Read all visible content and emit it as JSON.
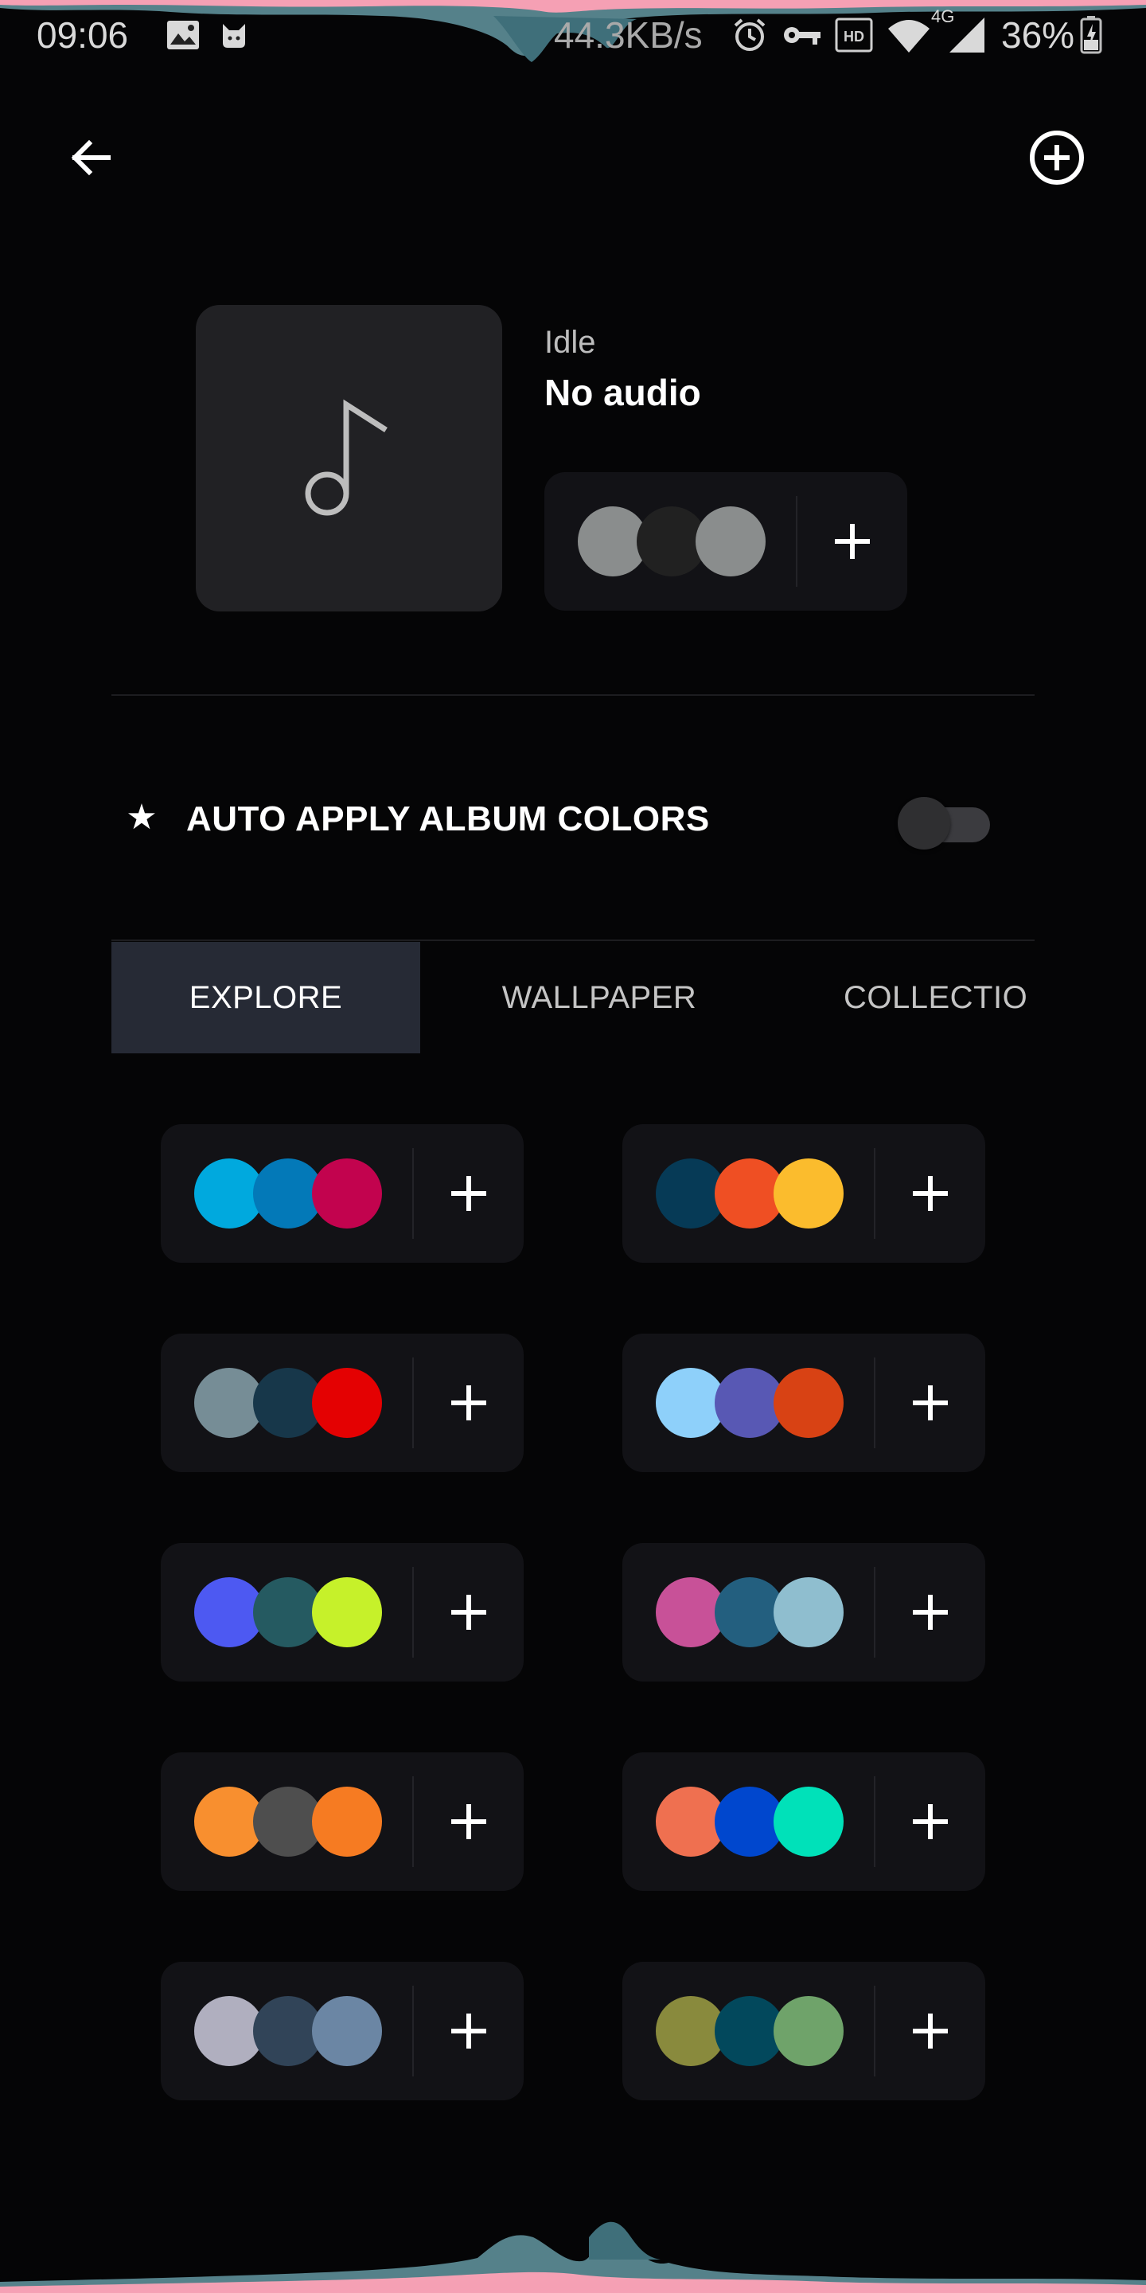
{
  "status_bar": {
    "time": "09:06",
    "net_speed": "44.3KB/s",
    "network_type": "4G",
    "battery": "36%",
    "icons": [
      "image-icon",
      "cat-icon",
      "alarm-icon",
      "vpn-key-icon",
      "hd-icon",
      "wifi-icon",
      "signal-icon",
      "battery-icon"
    ]
  },
  "header": {
    "back_icon": "arrow-back-icon",
    "add_icon": "add-circle-icon"
  },
  "now_playing": {
    "artwork_icon": "music-note-icon",
    "status": "Idle",
    "title": "No audio",
    "palette": [
      "#8a8d8d",
      "#212121",
      "#8a8d8d"
    ],
    "add_icon": "plus-icon"
  },
  "auto_apply": {
    "icon": "star-icon",
    "star_glyph": "★",
    "label": "AUTO APPLY ALBUM COLORS",
    "enabled": false
  },
  "tabs": [
    {
      "label": "EXPLORE",
      "active": true
    },
    {
      "label": "WALLPAPER",
      "active": false
    },
    {
      "label": "COLLECTIO",
      "active": false
    }
  ],
  "palettes": [
    [
      "#00a9de",
      "#0379b8",
      "#c2034e"
    ],
    [
      "#063a56",
      "#ef4f23",
      "#fbbc2d"
    ],
    [
      "#768d96",
      "#17374a",
      "#e40102"
    ],
    [
      "#8ed0fa",
      "#5858b4",
      "#d84214"
    ],
    [
      "#4d59f2",
      "#255a61",
      "#c6f12a"
    ],
    [
      "#c85198",
      "#235f7f",
      "#8fbecf"
    ],
    [
      "#f88f2f",
      "#4e4e4e",
      "#f67b22"
    ],
    [
      "#ef7050",
      "#0047ce",
      "#00e1b9"
    ],
    [
      "#b0afbf",
      "#314458",
      "#6b86a4"
    ],
    [
      "#898a3d",
      "#02485c",
      "#6fa36a"
    ]
  ],
  "colors": {
    "background": "#050506",
    "card": "#121216",
    "active_tab": "#262a35",
    "wave_pink": "#f5a0b4",
    "wave_teal": "#5e8f99"
  }
}
